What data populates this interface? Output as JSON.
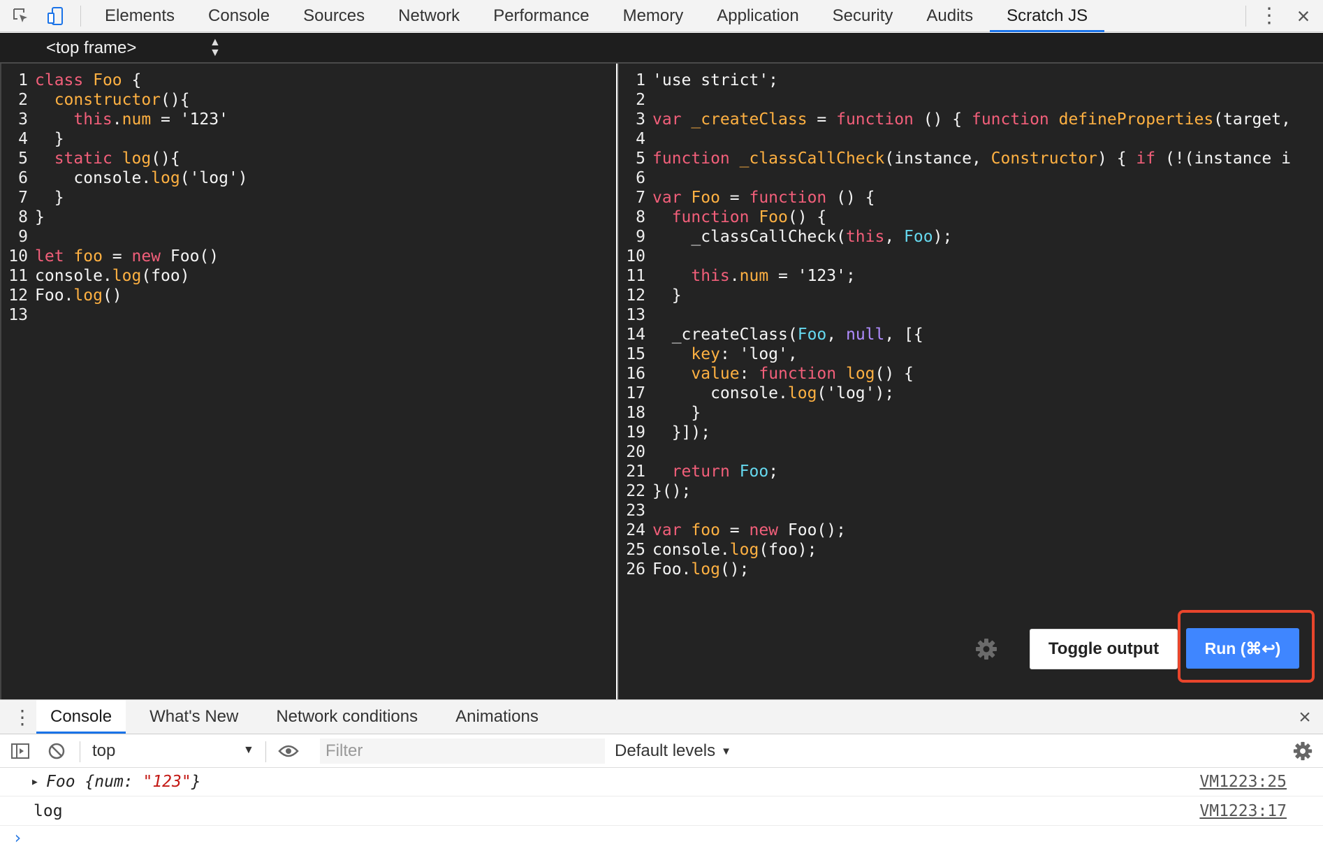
{
  "toolbar": {
    "tabs": [
      "Elements",
      "Console",
      "Sources",
      "Network",
      "Performance",
      "Memory",
      "Application",
      "Security",
      "Audits",
      "Scratch JS"
    ],
    "active_tab": "Scratch JS"
  },
  "frame_selector": {
    "value": "<top frame>"
  },
  "left_editor": {
    "lines": [
      [
        [
          "k",
          "class "
        ],
        [
          "n",
          "Foo "
        ],
        [
          "p",
          "{"
        ]
      ],
      [
        [
          "p",
          "  "
        ],
        [
          "f",
          "constructor"
        ],
        [
          "p",
          "(){"
        ]
      ],
      [
        [
          "p",
          "    "
        ],
        [
          "k",
          "this"
        ],
        [
          "p",
          "."
        ],
        [
          "f",
          "num"
        ],
        [
          "p",
          " = '123'"
        ]
      ],
      [
        [
          "p",
          "  }"
        ]
      ],
      [
        [
          "p",
          "  "
        ],
        [
          "k",
          "static "
        ],
        [
          "f",
          "log"
        ],
        [
          "p",
          "(){"
        ]
      ],
      [
        [
          "p",
          "    console."
        ],
        [
          "f",
          "log"
        ],
        [
          "p",
          "('log')"
        ]
      ],
      [
        [
          "p",
          "  }"
        ]
      ],
      [
        [
          "p",
          "}"
        ]
      ],
      [
        [
          "p",
          ""
        ]
      ],
      [
        [
          "k",
          "let "
        ],
        [
          "n",
          "foo"
        ],
        [
          "p",
          " = "
        ],
        [
          "k",
          "new "
        ],
        [
          "p",
          "Foo()"
        ]
      ],
      [
        [
          "p",
          "console."
        ],
        [
          "f",
          "log"
        ],
        [
          "p",
          "(foo)"
        ]
      ],
      [
        [
          "p",
          "Foo."
        ],
        [
          "f",
          "log"
        ],
        [
          "p",
          "()"
        ]
      ],
      [
        [
          "p",
          ""
        ]
      ]
    ]
  },
  "right_editor": {
    "lines": [
      [
        [
          "s",
          "'use strict';"
        ]
      ],
      [
        [
          "p",
          ""
        ]
      ],
      [
        [
          "k",
          "var "
        ],
        [
          "n",
          "_createClass"
        ],
        [
          "p",
          " = "
        ],
        [
          "k",
          "function"
        ],
        [
          "p",
          " () { "
        ],
        [
          "k",
          "function "
        ],
        [
          "n",
          "defineProperties"
        ],
        [
          "p",
          "(target,"
        ]
      ],
      [
        [
          "p",
          ""
        ]
      ],
      [
        [
          "k",
          "function "
        ],
        [
          "n",
          "_classCallCheck"
        ],
        [
          "p",
          "(instance, "
        ],
        [
          "n",
          "Constructor"
        ],
        [
          "p",
          ") { "
        ],
        [
          "k",
          "if"
        ],
        [
          "p",
          " (!(instance i"
        ]
      ],
      [
        [
          "p",
          ""
        ]
      ],
      [
        [
          "k",
          "var "
        ],
        [
          "n",
          "Foo"
        ],
        [
          "p",
          " = "
        ],
        [
          "k",
          "function"
        ],
        [
          "p",
          " () {"
        ]
      ],
      [
        [
          "p",
          "  "
        ],
        [
          "k",
          "function "
        ],
        [
          "n",
          "Foo"
        ],
        [
          "p",
          "() {"
        ]
      ],
      [
        [
          "p",
          "    _classCallCheck("
        ],
        [
          "k",
          "this"
        ],
        [
          "p",
          ", "
        ],
        [
          "c",
          "Foo"
        ],
        [
          "p",
          ");"
        ]
      ],
      [
        [
          "p",
          ""
        ]
      ],
      [
        [
          "p",
          "    "
        ],
        [
          "k",
          "this"
        ],
        [
          "p",
          "."
        ],
        [
          "f",
          "num"
        ],
        [
          "p",
          " = '123';"
        ]
      ],
      [
        [
          "p",
          "  }"
        ]
      ],
      [
        [
          "p",
          ""
        ]
      ],
      [
        [
          "p",
          "  _createClass("
        ],
        [
          "c",
          "Foo"
        ],
        [
          "p",
          ", "
        ],
        [
          "m",
          "null"
        ],
        [
          "p",
          ", [{"
        ]
      ],
      [
        [
          "p",
          "    "
        ],
        [
          "f",
          "key"
        ],
        [
          "p",
          ": 'log',"
        ]
      ],
      [
        [
          "p",
          "    "
        ],
        [
          "f",
          "value"
        ],
        [
          "p",
          ": "
        ],
        [
          "k",
          "function "
        ],
        [
          "n",
          "log"
        ],
        [
          "p",
          "() {"
        ]
      ],
      [
        [
          "p",
          "      console."
        ],
        [
          "f",
          "log"
        ],
        [
          "p",
          "('log');"
        ]
      ],
      [
        [
          "p",
          "    }"
        ]
      ],
      [
        [
          "p",
          "  }]);"
        ]
      ],
      [
        [
          "p",
          ""
        ]
      ],
      [
        [
          "p",
          "  "
        ],
        [
          "k",
          "return "
        ],
        [
          "c",
          "Foo"
        ],
        [
          "p",
          ";"
        ]
      ],
      [
        [
          "p",
          "}();"
        ]
      ],
      [
        [
          "p",
          ""
        ]
      ],
      [
        [
          "k",
          "var "
        ],
        [
          "n",
          "foo"
        ],
        [
          "p",
          " = "
        ],
        [
          "k",
          "new "
        ],
        [
          "p",
          "Foo();"
        ]
      ],
      [
        [
          "p",
          "console."
        ],
        [
          "f",
          "log"
        ],
        [
          "p",
          "(foo);"
        ]
      ],
      [
        [
          "p",
          "Foo."
        ],
        [
          "f",
          "log"
        ],
        [
          "p",
          "();"
        ]
      ]
    ]
  },
  "buttons": {
    "toggle_output": "Toggle output",
    "run": "Run (⌘↩)"
  },
  "drawer": {
    "tabs": [
      "Console",
      "What's New",
      "Network conditions",
      "Animations"
    ],
    "active_tab": "Console"
  },
  "console_bar": {
    "context": "top",
    "filter_placeholder": "Filter",
    "levels": "Default levels"
  },
  "messages": [
    {
      "prefix": "Foo {num: ",
      "value": "\"123\"",
      "suffix": "}",
      "source": "VM1223:25"
    },
    {
      "text": "log",
      "source": "VM1223:17"
    }
  ],
  "prompt": "›",
  "colors": {
    "accent": "#1a73e8",
    "run_button": "#3f86ff",
    "highlight": "#e8452c",
    "editor_bg": "#232323"
  }
}
